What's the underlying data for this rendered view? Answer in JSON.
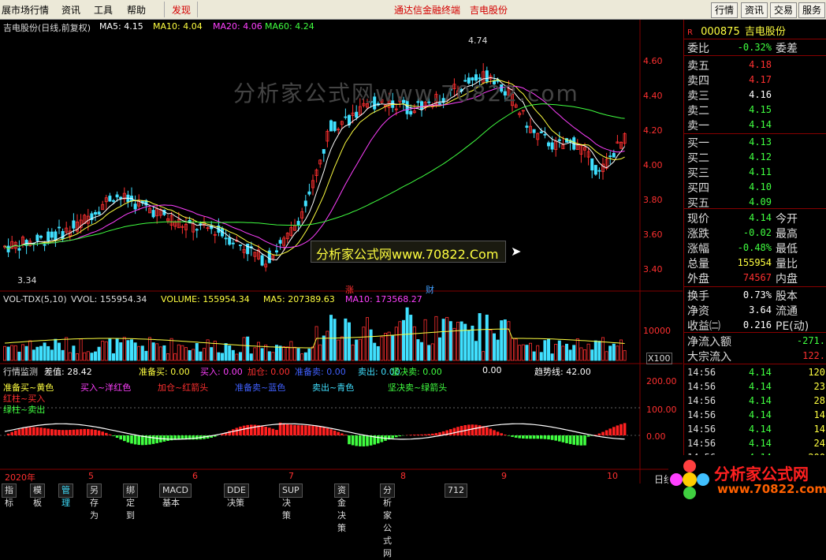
{
  "menu": {
    "items": [
      "展市场行情",
      "资讯",
      "工具",
      "帮助"
    ],
    "highlight": "发现",
    "center_links": [
      "通达信金融终端",
      "吉电股份"
    ],
    "right_buttons": [
      "行情",
      "资讯",
      "交易",
      "服务"
    ]
  },
  "chart_header": {
    "title": "吉电股份(日线,前复权)",
    "ma5": "MA5: 4.15",
    "ma10": "MA10: 4.04",
    "ma20": "MA20: 4.06",
    "ma60": "MA60: 4.24"
  },
  "price_axis": [
    "4.60",
    "4.40",
    "4.20",
    "4.00",
    "3.80",
    "3.60",
    "3.40"
  ],
  "annotations": {
    "high": "4.74",
    "low": "3.34",
    "zhang": "涨",
    "cai": "财"
  },
  "watermark": {
    "top": "分析家公式网www.70822.com",
    "banner": "分析家公式网www.70822.Com"
  },
  "volume_header": {
    "name": "VOL-TDX(5,10)",
    "vvol": "VVOL: 155954.34",
    "volume": "VOLUME: 155954.34",
    "ma5": "MA5: 207389.63",
    "ma10": "MA10: 173568.27"
  },
  "volume_axis": {
    "tick": "10000",
    "unit": "X100"
  },
  "indicator_header": {
    "name": "行情监测",
    "diff": "差值: 28.42",
    "prep_buy": "准备买: 0.00",
    "buy": "买入: 0.00",
    "add": "加仓: 0.00",
    "prep_sell": "准备卖: 0.00",
    "sell": "卖出: 0.00",
    "firm_sell": "坚决卖: 0.00",
    "extra": "0.00",
    "trend": "趋势线: 42.00"
  },
  "indicator_legend": {
    "l1": "准备买~黄色",
    "l2": "买入~洋红色",
    "l3": "加仓~红箭头",
    "l4": "准备卖~蓝色",
    "l5": "卖出~青色",
    "l6": "坚决卖~绿箭头",
    "l7": "红柱~买入",
    "l8": "绿柱~卖出"
  },
  "indicator_axis": [
    "200.00",
    "100.00",
    "0.00"
  ],
  "date_axis": [
    "2020年",
    "5",
    "6",
    "7",
    "8",
    "9",
    "10"
  ],
  "bottom_tabs": [
    "指标",
    "模板",
    "管理",
    "另存为",
    "绑定到",
    "MACD基本",
    "DDE决策",
    "SUP决策",
    "资金决策",
    "分析家公式网",
    "712"
  ],
  "bottom_right": "日线",
  "quote": {
    "code": "000875",
    "name": "吉电股份",
    "weibi_label": "委比",
    "weibi": "-0.32%",
    "weicha_label": "委差",
    "asks": [
      {
        "label": "卖五",
        "price": "4.18"
      },
      {
        "label": "卖四",
        "price": "4.17"
      },
      {
        "label": "卖三",
        "price": "4.16"
      },
      {
        "label": "卖二",
        "price": "4.15"
      },
      {
        "label": "卖一",
        "price": "4.14"
      }
    ],
    "bids": [
      {
        "label": "买一",
        "price": "4.13"
      },
      {
        "label": "买二",
        "price": "4.12"
      },
      {
        "label": "买三",
        "price": "4.11"
      },
      {
        "label": "买四",
        "price": "4.10"
      },
      {
        "label": "买五",
        "price": "4.09"
      }
    ],
    "stats": [
      {
        "k": "现价",
        "v": "4.14",
        "k2": "今开",
        "color": "#40ff40"
      },
      {
        "k": "涨跌",
        "v": "-0.02",
        "k2": "最高",
        "color": "#40ff40"
      },
      {
        "k": "涨幅",
        "v": "-0.48%",
        "k2": "最低",
        "color": "#40ff40"
      },
      {
        "k": "总量",
        "v": "155954",
        "k2": "量比",
        "color": "#ffff40"
      },
      {
        "k": "外盘",
        "v": "74567",
        "k2": "内盘",
        "color": "#ff3030"
      }
    ],
    "stats2": [
      {
        "k": "换手",
        "v": "0.73%",
        "k2": "股本",
        "color": "#ffffff"
      },
      {
        "k": "净资",
        "v": "3.64",
        "k2": "流通",
        "color": "#ffffff"
      },
      {
        "k": "收益㈡",
        "v": "0.216",
        "k2": "PE(动)",
        "color": "#ffffff"
      }
    ],
    "flow": [
      {
        "k": "净流入额",
        "v": "-271.",
        "color": "#40ff40"
      },
      {
        "k": "大宗流入",
        "v": "122.",
        "color": "#ff3030"
      }
    ],
    "ticks": [
      {
        "t": "14:56",
        "p": "4.14",
        "q": "120"
      },
      {
        "t": "14:56",
        "p": "4.14",
        "q": "23"
      },
      {
        "t": "14:56",
        "p": "4.14",
        "q": "28"
      },
      {
        "t": "14:56",
        "p": "4.14",
        "q": "14"
      },
      {
        "t": "14:56",
        "p": "4.14",
        "q": "14"
      },
      {
        "t": "14:56",
        "p": "4.14",
        "q": "24"
      },
      {
        "t": "14:56",
        "p": "4.14",
        "q": "200"
      }
    ]
  },
  "logo": {
    "text": "分析家公式网",
    "url": "www.70822.com"
  },
  "colors": {
    "up": "#ff3030",
    "down": "#40e0ff",
    "ma5": "#ffffff",
    "ma10": "#ffff40",
    "ma20": "#ff40ff",
    "ma60": "#40ff40",
    "grid": "#800000"
  }
}
